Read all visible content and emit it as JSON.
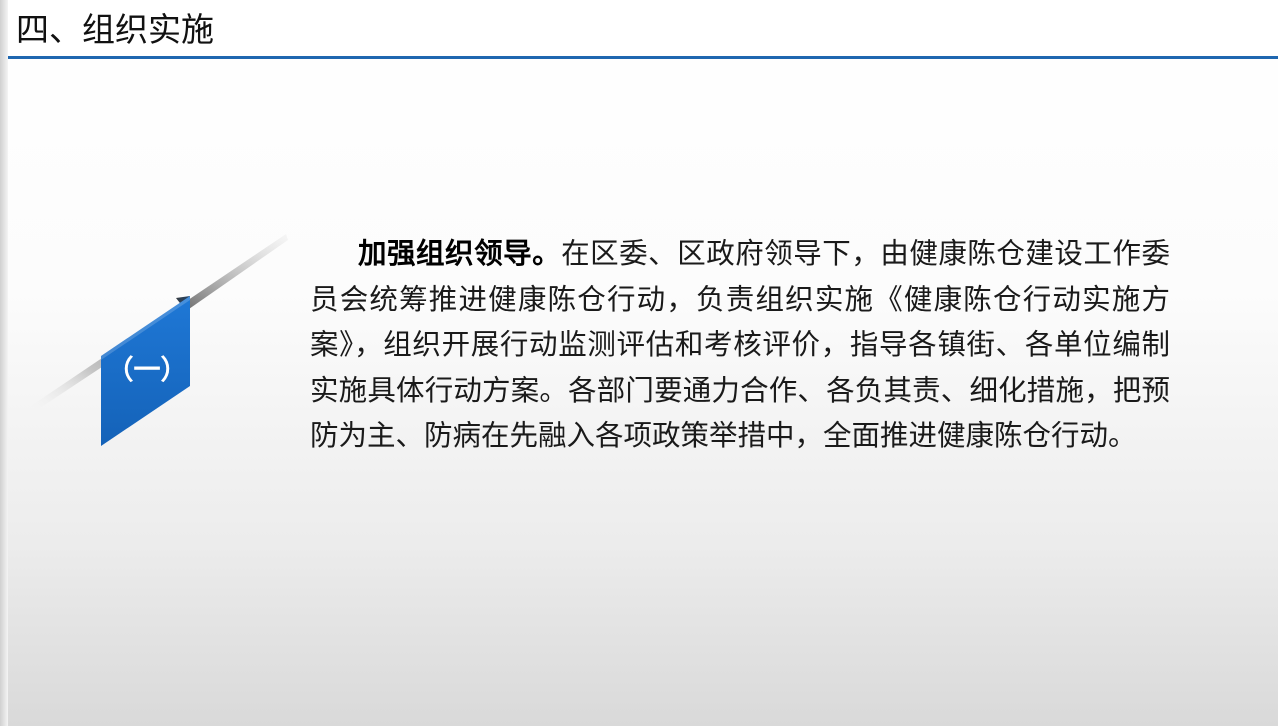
{
  "header": {
    "title": "四、组织实施"
  },
  "section": {
    "number": "（一）",
    "lead": "加强组织领导。",
    "body": "在区委、区政府领导下，由健康陈仓建设工作委员会统筹推进健康陈仓行动，负责组织实施《健康陈仓行动实施方案》，组织开展行动监测评估和考核评价，指导各镇街、各单位编制实施具体行动方案。各部门要通力合作、各负其责、细化措施，把预防为主、防病在先融入各项政策举措中，全面推进健康陈仓行动。"
  },
  "colors": {
    "accent": "#1f67b0",
    "ribbon": "#1a6cc6",
    "text": "#1a1a1a"
  }
}
